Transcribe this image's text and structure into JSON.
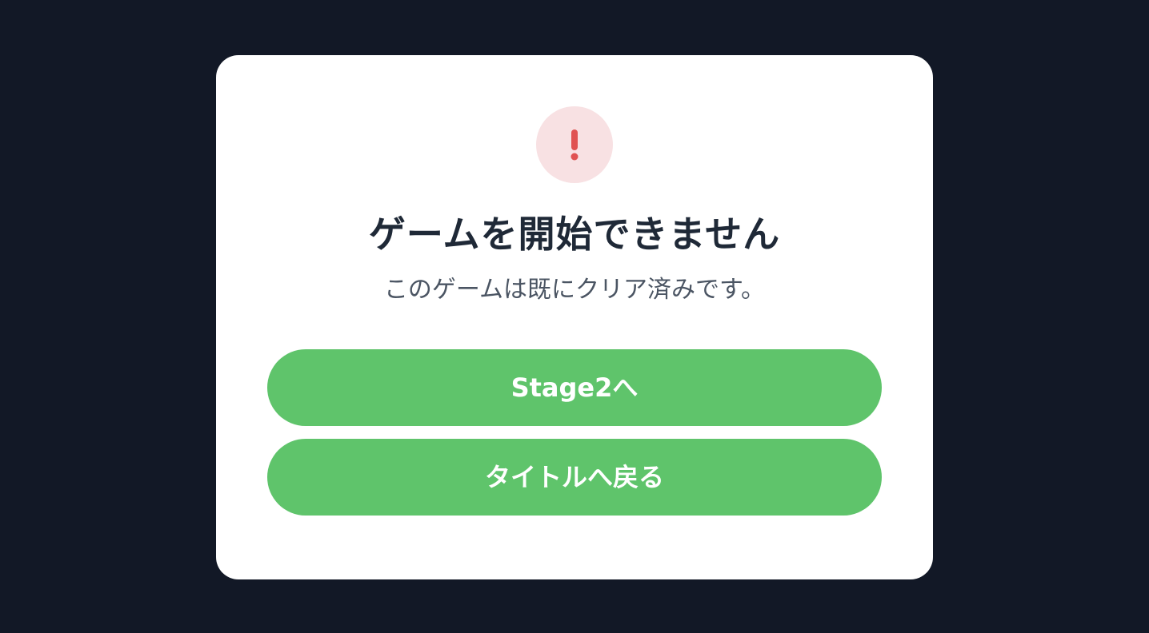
{
  "dialog": {
    "icon": "exclamation-icon",
    "title": "ゲームを開始できません",
    "message": "このゲームは既にクリア済みです。",
    "buttons": {
      "next_stage_label": "Stage2へ",
      "back_to_title_label": "タイトルへ戻る"
    }
  },
  "colors": {
    "background": "#121826",
    "dialog": "#ffffff",
    "icon_bg": "#f8e1e3",
    "icon_fg": "#e05252",
    "title": "#1f2937",
    "message": "#4b5563",
    "button": "#5fc46b",
    "button_text": "#ffffff"
  }
}
